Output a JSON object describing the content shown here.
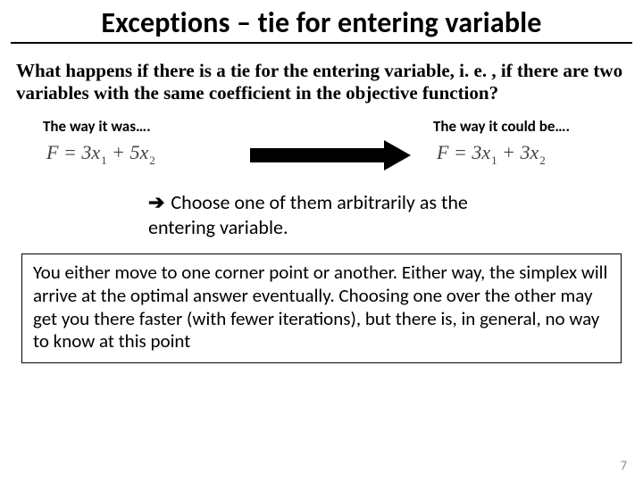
{
  "title": "Exceptions – tie for entering variable",
  "question": "What happens if there is a tie for the entering variable, i. e. , if there are two variables with the same coefficient in the objective function?",
  "left_caption": "The way it was….",
  "right_caption": "The way it could be….",
  "formula_left": {
    "lhs": "F",
    "c1": "3",
    "v1": "x",
    "s1": "1",
    "c2": "5",
    "v2": "x",
    "s2": "2"
  },
  "formula_right": {
    "lhs": "F",
    "c1": "3",
    "v1": "x",
    "s1": "1",
    "c2": "3",
    "v2": "x",
    "s2": "2"
  },
  "choose_lead": "➔",
  "choose_text": " Choose one of them arbitrarily as the entering variable.",
  "box_text": "You either move to one corner point or another. Either way, the simplex will arrive at the optimal answer eventually. Choosing one over the other may get you there faster (with fewer iterations), but there is, in general, no way to know at this point",
  "page_number": "7"
}
